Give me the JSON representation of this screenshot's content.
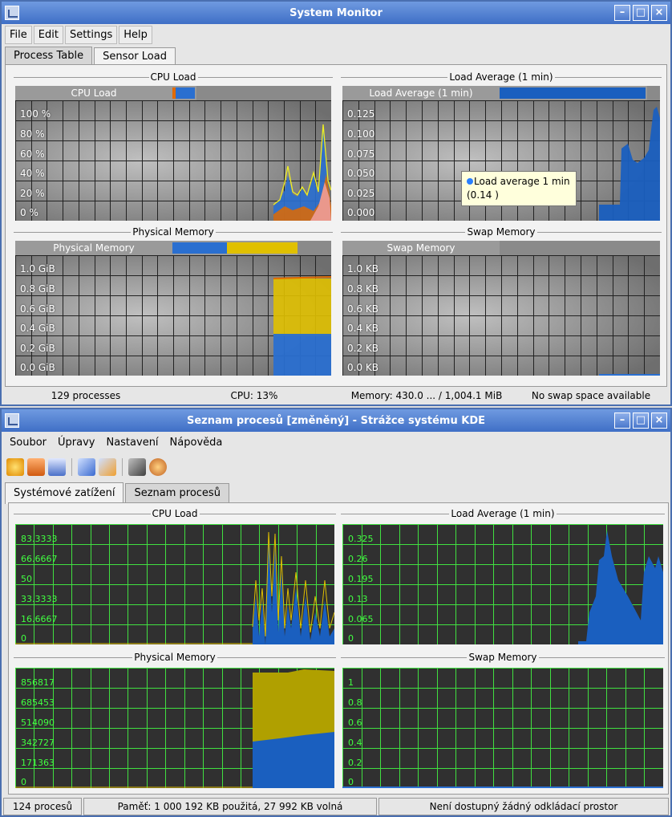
{
  "w1": {
    "title": "System Monitor",
    "menu": [
      "File",
      "Edit",
      "Settings",
      "Help"
    ],
    "tabs": [
      "Process Table",
      "Sensor Load"
    ],
    "cpu": {
      "title": "CPU Load",
      "header": "CPU Load",
      "ylabels": [
        "100 %",
        "80 %",
        "60 %",
        "40 %",
        "20 %",
        "0 %"
      ]
    },
    "load": {
      "title": "Load Average (1 min)",
      "header": "Load Average (1 min)",
      "ylabels": [
        "0.125",
        "0.100",
        "0.075",
        "0.050",
        "0.025",
        "0.000"
      ],
      "tooltip_line1": "Load average 1 min",
      "tooltip_line2": "(0.14 )"
    },
    "phys": {
      "title": "Physical Memory",
      "header": "Physical Memory",
      "ylabels": [
        "1.0 GiB",
        "0.8 GiB",
        "0.6 GiB",
        "0.4 GiB",
        "0.2 GiB",
        "0.0 GiB"
      ]
    },
    "swap": {
      "title": "Swap Memory",
      "header": "Swap Memory",
      "ylabels": [
        "1.0 KB",
        "0.8 KB",
        "0.6 KB",
        "0.4 KB",
        "0.2 KB",
        "0.0 KB"
      ]
    },
    "status": {
      "processes": "129 processes",
      "cpu": "CPU: 13%",
      "memory": "Memory: 430.0 ... / 1,004.1 MiB",
      "swap": "No swap space available"
    },
    "colors": {
      "cpu_header_fill": "#2a6fd0",
      "load_header_fill": "#1a5fbf",
      "mem_used": "#2a6fd0",
      "mem_cache": "#e0c000"
    }
  },
  "w2": {
    "title": "Seznam procesů [změněný] - Strážce systému KDE",
    "menu": [
      "Soubor",
      "Úpravy",
      "Nastavení",
      "Nápověda"
    ],
    "tabs": [
      "Systémové zatížení",
      "Seznam procesů"
    ],
    "cpu": {
      "title": "CPU Load",
      "ylabels": [
        "83.3333",
        "66.6667",
        "50",
        "33.3333",
        "16.6667",
        "0"
      ]
    },
    "load": {
      "title": "Load Average (1 min)",
      "ylabels": [
        "0.325",
        "0.26",
        "0.195",
        "0.13",
        "0.065",
        "0"
      ]
    },
    "phys": {
      "title": "Physical Memory",
      "ylabels": [
        "856817",
        "685453",
        "514090",
        "342727",
        "171363",
        "0"
      ]
    },
    "swap": {
      "title": "Swap Memory",
      "ylabels": [
        "1",
        "0.8",
        "0.6",
        "0.4",
        "0.2",
        "0"
      ]
    },
    "status": {
      "processes": "124 procesů",
      "memory": "Paměť: 1 000 192 KB použitá, 27 992 KB volná",
      "swap": "Není dostupný žádný odkládací prostor"
    },
    "toolbar_icons": [
      "new-icon",
      "open-icon",
      "edit-icon",
      "connect-icon",
      "disconnect-icon",
      "configure-icon",
      "palette-icon"
    ]
  }
}
